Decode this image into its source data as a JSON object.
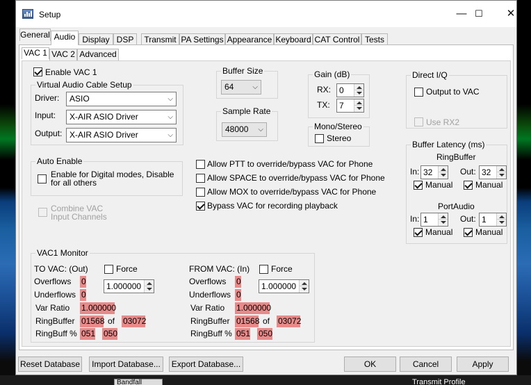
{
  "window": {
    "title": "Setup",
    "minimize": "—",
    "maximize": "☐",
    "close": "✕"
  },
  "tabs": [
    "General",
    "Audio",
    "Display",
    "DSP",
    "Transmit",
    "PA Settings",
    "Appearance",
    "Keyboard",
    "CAT Control",
    "Tests"
  ],
  "active_tab": "Audio",
  "subtabs": [
    "VAC 1",
    "VAC 2",
    "Advanced"
  ],
  "active_subtab": "VAC 1",
  "enable_vac1": {
    "label": "Enable VAC 1",
    "checked": true
  },
  "vac_setup": {
    "title": "Virtual Audio Cable Setup",
    "driver_label": "Driver:",
    "driver_value": "ASIO",
    "input_label": "Input:",
    "input_value": "X-AIR ASIO Driver",
    "output_label": "Output:",
    "output_value": "X-AIR ASIO Driver"
  },
  "buffer_size": {
    "title": "Buffer Size",
    "value": "64"
  },
  "sample_rate": {
    "title": "Sample Rate",
    "value": "48000"
  },
  "gain": {
    "title": "Gain (dB)",
    "rx_label": "RX:",
    "rx_value": "0",
    "tx_label": "TX:",
    "tx_value": "7"
  },
  "mono_stereo": {
    "title": "Mono/Stereo",
    "stereo_label": "Stereo",
    "stereo_checked": false
  },
  "direct_iq": {
    "title": "Direct I/Q",
    "output_label": "Output to VAC",
    "use_rx2_label": "Use RX2"
  },
  "auto_enable": {
    "title": "Auto Enable",
    "label_line1": "Enable for Digital modes, Disable",
    "label_line2": "for all others"
  },
  "combine_vac": {
    "line1": "Combine VAC",
    "line2": "Input Channels"
  },
  "options": [
    {
      "label": "Allow PTT to override/bypass VAC for Phone",
      "checked": false
    },
    {
      "label": "Allow SPACE to override/bypass VAC for Phone",
      "checked": false
    },
    {
      "label": "Allow MOX to override/bypass VAC for Phone",
      "checked": false
    },
    {
      "label": "Bypass VAC for recording playback",
      "checked": true
    }
  ],
  "latency": {
    "title": "Buffer Latency (ms)",
    "ringbuffer_title": "RingBuffer",
    "rb_in_label": "In:",
    "rb_in_value": "32",
    "rb_out_label": "Out:",
    "rb_out_value": "32",
    "manual_label": "Manual",
    "portaudio_title": "PortAudio",
    "pa_in_label": "In:",
    "pa_in_value": "1",
    "pa_out_label": "Out:",
    "pa_out_value": "1"
  },
  "monitor": {
    "title": "VAC1 Monitor",
    "to_vac": {
      "title": "TO VAC: (Out)",
      "force_label": "Force",
      "force_value": "1.000000",
      "overflows_label": "Overflows",
      "overflows": "0",
      "underflows_label": "Underflows",
      "underflows": "0",
      "var_ratio_label": "Var Ratio",
      "var_ratio": "1.000000",
      "ringbuffer_label": "RingBuffer",
      "rb_a": "01568",
      "of": "of",
      "rb_b": "03072",
      "ringbuff_pct_label": "RingBuff %",
      "pct_a": "051",
      "pct_b": "050"
    },
    "from_vac": {
      "title": "FROM VAC: (In)",
      "force_label": "Force",
      "force_value": "1.000000",
      "overflows_label": "Overflows",
      "overflows": "0",
      "underflows_label": "Underflows",
      "underflows": "0",
      "var_ratio_label": "Var Ratio",
      "var_ratio": "1.000000",
      "ringbuffer_label": "RingBuffer",
      "rb_a": "01568",
      "of": "of",
      "rb_b": "03072",
      "ringbuff_pct_label": "RingBuff %",
      "pct_a": "051",
      "pct_b": "050"
    }
  },
  "buttons": {
    "reset": "Reset Database",
    "import": "Import Database...",
    "export": "Export Database...",
    "ok": "OK",
    "cancel": "Cancel",
    "apply": "Apply"
  },
  "background": {
    "transmit_profile": "Transmit Profile",
    "combo": "Bandfall"
  },
  "colors": {
    "monitor_value_bg": "#e88a8a",
    "accent": "#0078d7"
  }
}
